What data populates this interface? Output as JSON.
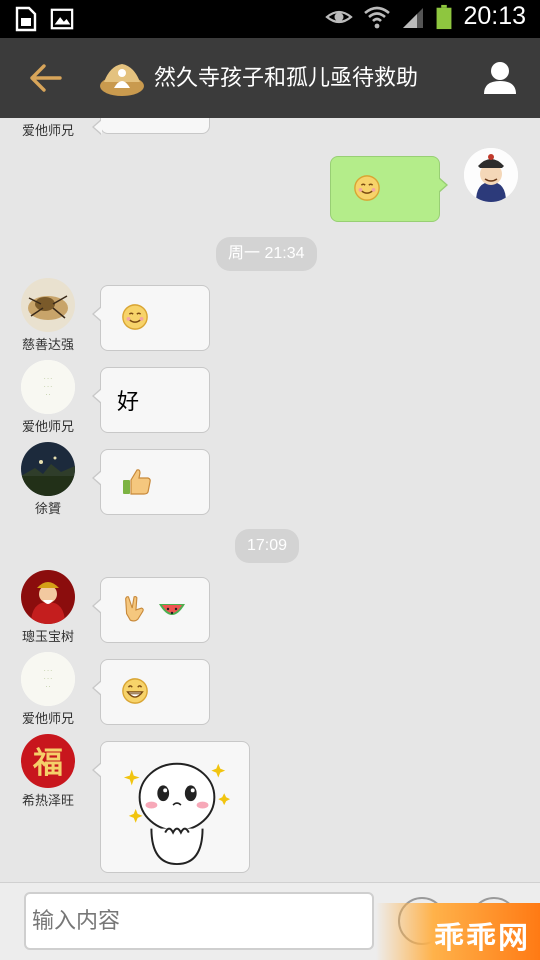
{
  "status_bar": {
    "time": "20:13",
    "icons": [
      "sim-card-icon",
      "image-icon",
      "eye-icon",
      "wifi-icon",
      "signal-icon",
      "battery-icon"
    ]
  },
  "header": {
    "title": "然久寺孩子和孤儿亟待救助",
    "back_icon": "back-arrow-icon",
    "profile_icon": "profile-icon",
    "bg_color": "#3b3b3b",
    "accent_color": "#d8a55a"
  },
  "chat": {
    "top_partial_sender": "爱他师兄",
    "my_message": {
      "content": "smile-emoji",
      "bubble_color": "#b4ed8a"
    },
    "timestamps": [
      "周一 21:34",
      "17:09"
    ],
    "messages": [
      {
        "sender": "慈善达强",
        "content": "smile-emoji"
      },
      {
        "sender": "爱他师兄",
        "text": "好"
      },
      {
        "sender": "徐贇",
        "content": "thumbs-up-emoji"
      },
      {
        "sender": "璁玉宝树",
        "content": [
          "victory-hand-emoji",
          "watermelon-emoji"
        ]
      },
      {
        "sender": "爱他师兄",
        "content": "grin-emoji"
      },
      {
        "sender": "希热泽旺",
        "content": "cute-sticker"
      }
    ]
  },
  "input_bar": {
    "placeholder": "输入内容",
    "emoji_icon": "emoji-icon",
    "more_icon": "more-icon",
    "watermark": "乖乖网"
  }
}
